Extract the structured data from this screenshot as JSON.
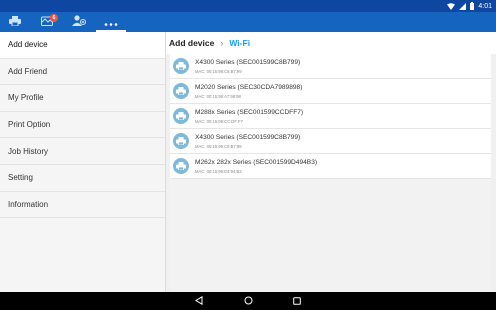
{
  "status_bar": {
    "time": "4:01"
  },
  "tabs": [
    {
      "icon": "printer-icon"
    },
    {
      "icon": "inbox-icon",
      "badge": "6"
    },
    {
      "icon": "add-friend-icon"
    },
    {
      "icon": "more-icon"
    }
  ],
  "sidebar": {
    "items": [
      {
        "label": "Add device"
      },
      {
        "label": "Add Friend"
      },
      {
        "label": "My Profile"
      },
      {
        "label": "Print Option"
      },
      {
        "label": "Job History"
      },
      {
        "label": "Setting"
      },
      {
        "label": "Information"
      }
    ]
  },
  "breadcrumb": {
    "root": "Add device",
    "current": "Wi-Fi"
  },
  "devices": [
    {
      "name": "X4300 Series (SEC001599C8B799)",
      "mac": "MAC: 00:15:99:C8:B7:99"
    },
    {
      "name": "M2020 Series (SEC30CDA7989898)",
      "mac": "MAC: 00:15:99:A7:98:98"
    },
    {
      "name": "M288x Series (SEC001599CCDFF7)",
      "mac": "MAC: 00:15:99:CC:DF:F7"
    },
    {
      "name": "X4300 Series (SEC001599C8B799)",
      "mac": "MAC: 00:15:99:C8:B7:99"
    },
    {
      "name": "M262x 282x Series (SEC001599D494B3)",
      "mac": "MAC: 00:15:99:D4:94:B3"
    }
  ],
  "colors": {
    "status_bar": "#0d47a1",
    "app_bar": "#1565c0",
    "accent": "#2196f3",
    "badge": "#ef5350",
    "device_icon": "#7fb8d8"
  }
}
